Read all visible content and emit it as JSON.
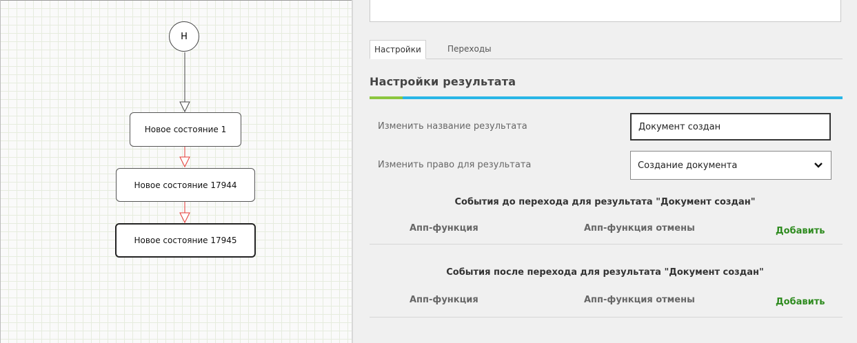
{
  "diagram": {
    "start_node": "Н",
    "states": [
      "Новое состояние 1",
      "Новое состояние 17944",
      "Новое состояние 17945"
    ]
  },
  "panel": {
    "tabs": [
      {
        "label": "Настройки",
        "active": true
      },
      {
        "label": "Переходы",
        "active": false
      }
    ],
    "section_title": "Настройки результата",
    "rename_label": "Изменить название результата",
    "rename_value": "Документ создан",
    "right_label": "Изменить право для результата",
    "right_value": "Создание документа",
    "events_before": {
      "title": "События до перехода для результата \"Документ создан\"",
      "col1": "Апп-функция",
      "col2": "Апп-функция отмены",
      "add": "Добавить"
    },
    "events_after": {
      "title": "События после перехода для результата \"Документ создан\"",
      "col1": "Апп-функция",
      "col2": "Апп-функция отмены",
      "add": "Добавить"
    }
  },
  "colors": {
    "accent_blue": "#29b6e6",
    "accent_green": "#8cc63f",
    "add_link": "#2e8b1f",
    "transition_arrow": "#e53935"
  }
}
